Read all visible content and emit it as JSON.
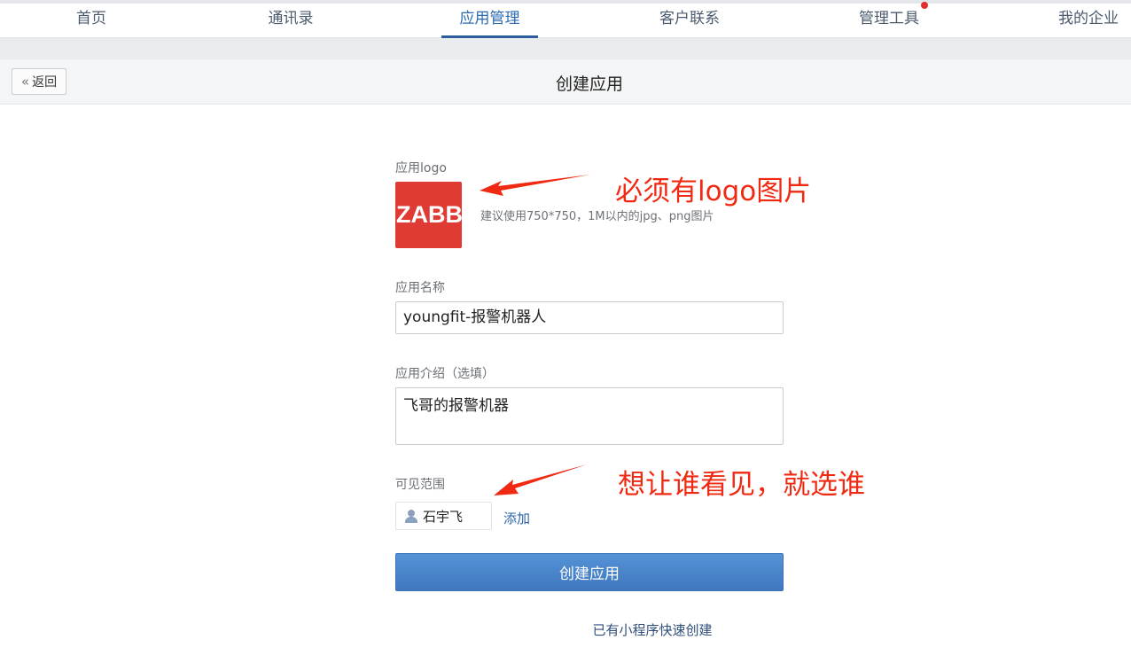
{
  "nav": {
    "items": [
      {
        "label": "首页"
      },
      {
        "label": "通讯录"
      },
      {
        "label": "应用管理"
      },
      {
        "label": "客户联系"
      },
      {
        "label": "管理工具"
      },
      {
        "label": "我的企业"
      }
    ],
    "active_index": 2
  },
  "subheader": {
    "back_label": "返回",
    "title": "创建应用"
  },
  "form": {
    "logo_label": "应用logo",
    "logo_text": "ZABBIX",
    "logo_hint": "建议使用750*750，1M以内的jpg、png图片",
    "name_label": "应用名称",
    "name_value": "youngfit-报警机器人",
    "desc_label": "应用介绍（选填）",
    "desc_value": "飞哥的报警机器",
    "scope_label": "可见范围",
    "scope_member": "石宇飞",
    "add_label": "添加",
    "submit_label": "创建应用",
    "mini_program_link": "已有小程序快速创建"
  },
  "annotations": {
    "logo_note": "必须有logo图片",
    "scope_note": "想让谁看见，就选谁"
  },
  "colors": {
    "accent": "#2a5d9a",
    "button": "#4a86cc",
    "annotation": "#f02a12",
    "logo_bg": "#e03a35"
  }
}
